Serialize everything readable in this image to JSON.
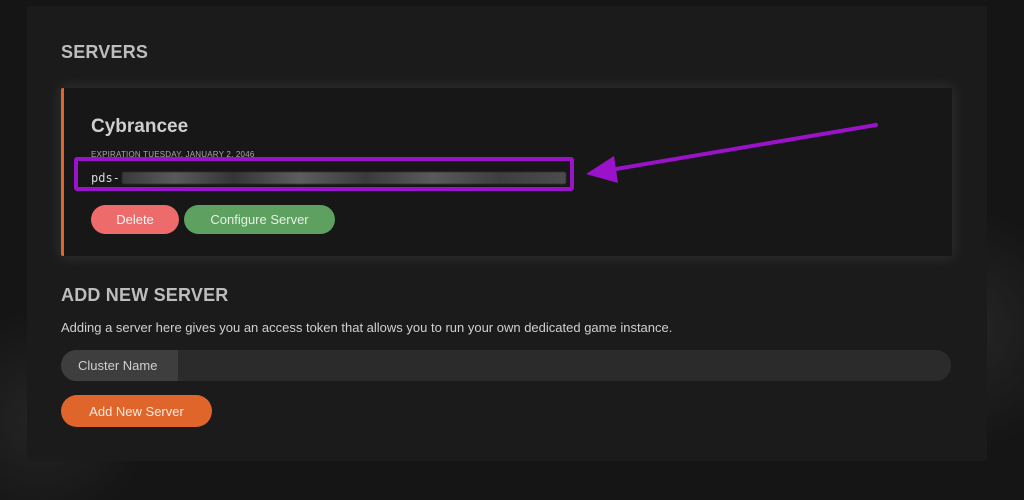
{
  "servers": {
    "title": "SERVERS",
    "items": [
      {
        "name": "Cybrancee",
        "expiration": "EXPIRATION TUESDAY, JANUARY 2, 2046",
        "token_prefix": "pds-",
        "delete_label": "Delete",
        "configure_label": "Configure Server"
      }
    ]
  },
  "add_server": {
    "title": "ADD NEW SERVER",
    "description": "Adding a server here gives you an access token that allows you to run your own dedicated game instance.",
    "cluster_label": "Cluster Name",
    "cluster_value": "",
    "add_label": "Add New Server"
  },
  "colors": {
    "accent": "#e0652b",
    "delete": "#ee6b6b",
    "configure": "#5ea05f",
    "annotation": "#9a12c9"
  }
}
